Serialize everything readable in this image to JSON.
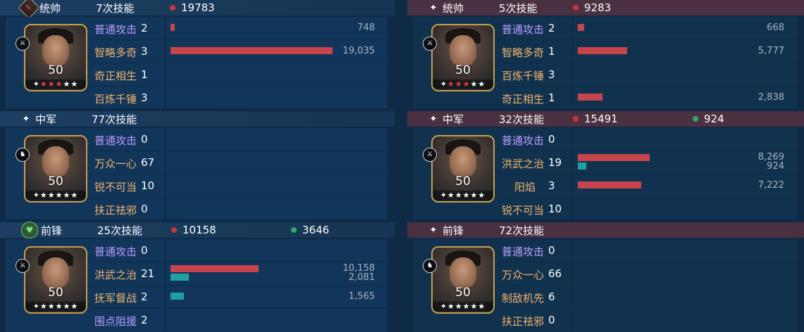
{
  "left": [
    {
      "header": {
        "role": "统帅",
        "role_icon": "shield-icon",
        "skills": "7次技能",
        "damage": "19783",
        "heal": ""
      },
      "portrait": {
        "level": "50",
        "stars_red": 3,
        "stars_white": 3,
        "tag_icon": "sword-icon"
      },
      "skills": [
        {
          "name": "普通攻击",
          "count": "2",
          "type": "normal",
          "value": "748",
          "value2": "",
          "fill": 0.02,
          "fill2": 0
        },
        {
          "name": "智略多奇",
          "count": "3",
          "type": "skill",
          "value": "19,035",
          "value2": "",
          "fill": 0.99,
          "fill2": 0
        },
        {
          "name": "奇正相生",
          "count": "1",
          "type": "skill",
          "value": "",
          "value2": "",
          "fill": 0,
          "fill2": 0
        },
        {
          "name": "百炼千锤",
          "count": "3",
          "type": "skill",
          "value": "",
          "value2": "",
          "fill": 0,
          "fill2": 0
        }
      ]
    },
    {
      "header": {
        "role": "中军",
        "role_icon": "star-icon",
        "skills": "77次技能",
        "damage": "",
        "heal": ""
      },
      "portrait": {
        "level": "50",
        "stars_red": 0,
        "stars_white": 6,
        "tag_icon": "horse-icon"
      },
      "skills": [
        {
          "name": "普通攻击",
          "count": "0",
          "type": "normal",
          "value": "",
          "value2": "",
          "fill": 0,
          "fill2": 0
        },
        {
          "name": "万众一心",
          "count": "67",
          "type": "skill",
          "value": "",
          "value2": "",
          "fill": 0,
          "fill2": 0
        },
        {
          "name": "锐不可当",
          "count": "10",
          "type": "skill",
          "value": "",
          "value2": "",
          "fill": 0,
          "fill2": 0
        },
        {
          "name": "扶正祛邪",
          "count": "0",
          "type": "skill",
          "value": "",
          "value2": "",
          "fill": 0,
          "fill2": 0
        }
      ]
    },
    {
      "header": {
        "role": "前锋",
        "role_icon": "heart-icon",
        "skills": "25次技能",
        "damage": "10158",
        "heal": "3646"
      },
      "portrait": {
        "level": "50",
        "stars_red": 0,
        "stars_white": 6,
        "tag_icon": "sword-icon"
      },
      "skills": [
        {
          "name": "普通攻击",
          "count": "0",
          "type": "normal",
          "value": "",
          "value2": "",
          "fill": 0,
          "fill2": 0
        },
        {
          "name": "洪武之治",
          "count": "21",
          "type": "skill",
          "value": "10,158",
          "value2": "2,081",
          "fill": 0.54,
          "fill2": 0.11
        },
        {
          "name": "抚军督战",
          "count": "2",
          "type": "skill",
          "value": "1,565",
          "value2": "",
          "fill": 0,
          "fill2": 0.08
        },
        {
          "name": "围点阻援",
          "count": "2",
          "type": "normal",
          "value": "",
          "value2": "",
          "fill": 0,
          "fill2": 0
        }
      ]
    }
  ],
  "right": [
    {
      "header": {
        "role": "统帅",
        "role_icon": "star-icon",
        "skills": "5次技能",
        "damage": "9283",
        "heal": ""
      },
      "portrait": {
        "level": "50",
        "stars_red": 3,
        "stars_white": 3,
        "tag_icon": "sword-icon"
      },
      "skills": [
        {
          "name": "普通攻击",
          "count": "2",
          "type": "normal",
          "value": "668",
          "value2": "",
          "fill": 0.04,
          "fill2": 0
        },
        {
          "name": "智略多奇",
          "count": "1",
          "type": "skill",
          "value": "5,777",
          "value2": "",
          "fill": 0.3,
          "fill2": 0
        },
        {
          "name": "百炼千锤",
          "count": "3",
          "type": "skill",
          "value": "",
          "value2": "",
          "fill": 0,
          "fill2": 0
        },
        {
          "name": "奇正相生",
          "count": "1",
          "type": "skill",
          "value": "2,838",
          "value2": "",
          "fill": 0.15,
          "fill2": 0
        }
      ]
    },
    {
      "header": {
        "role": "中军",
        "role_icon": "star-icon",
        "skills": "32次技能",
        "damage": "15491",
        "heal": "924"
      },
      "portrait": {
        "level": "50",
        "stars_red": 0,
        "stars_white": 6,
        "tag_icon": "sword-icon"
      },
      "skills": [
        {
          "name": "普通攻击",
          "count": "0",
          "type": "normal",
          "value": "",
          "value2": "",
          "fill": 0,
          "fill2": 0
        },
        {
          "name": "洪武之治",
          "count": "19",
          "type": "skill",
          "value": "8,269",
          "value2": "924",
          "fill": 0.44,
          "fill2": 0.05
        },
        {
          "name": "阳焰",
          "count": "3",
          "type": "skill",
          "value": "7,222",
          "value2": "",
          "fill": 0.39,
          "fill2": 0
        },
        {
          "name": "锐不可当",
          "count": "10",
          "type": "skill",
          "value": "",
          "value2": "",
          "fill": 0,
          "fill2": 0
        }
      ]
    },
    {
      "header": {
        "role": "前锋",
        "role_icon": "star-icon",
        "skills": "72次技能",
        "damage": "",
        "heal": ""
      },
      "portrait": {
        "level": "50",
        "stars_red": 0,
        "stars_white": 6,
        "tag_icon": "horse-icon"
      },
      "skills": [
        {
          "name": "普通攻击",
          "count": "0",
          "type": "normal",
          "value": "",
          "value2": "",
          "fill": 0,
          "fill2": 0
        },
        {
          "name": "万众一心",
          "count": "66",
          "type": "skill",
          "value": "",
          "value2": "",
          "fill": 0,
          "fill2": 0
        },
        {
          "name": "制敌机先",
          "count": "6",
          "type": "skill",
          "value": "",
          "value2": "",
          "fill": 0,
          "fill2": 0
        },
        {
          "name": "扶正祛邪",
          "count": "0",
          "type": "skill",
          "value": "",
          "value2": "",
          "fill": 0,
          "fill2": 0
        }
      ]
    }
  ],
  "colors": {
    "damage": "#c6454c",
    "heal": "#1fa1a3",
    "skill_name": "#efb46a",
    "normal_attack": "#b99cff",
    "gold_frame": "#c9a050"
  }
}
